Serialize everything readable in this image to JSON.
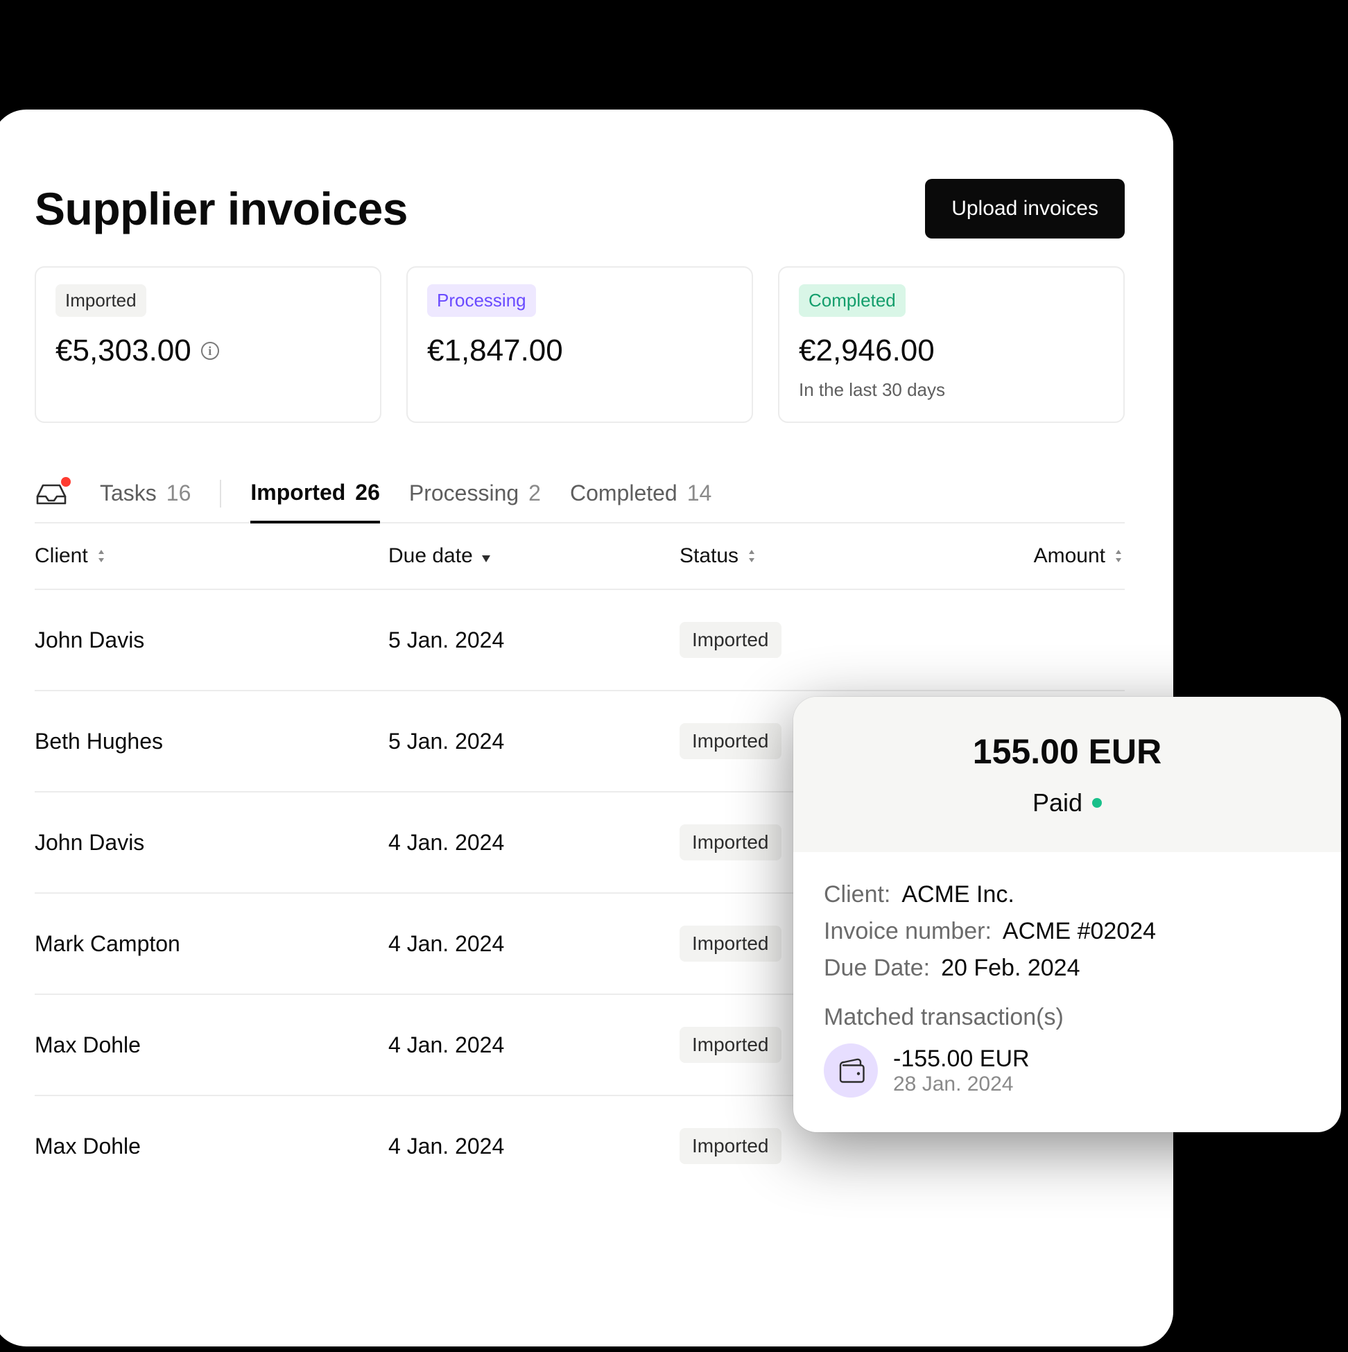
{
  "header": {
    "title": "Supplier invoices",
    "upload_button": "Upload invoices"
  },
  "summary_cards": {
    "imported": {
      "label": "Imported",
      "amount": "€5,303.00"
    },
    "processing": {
      "label": "Processing",
      "amount": "€1,847.00"
    },
    "completed": {
      "label": "Completed",
      "amount": "€2,946.00",
      "sub": "In the last 30 days"
    }
  },
  "tabs": {
    "tasks": {
      "label": "Tasks",
      "count": "16"
    },
    "imported": {
      "label": "Imported",
      "count": "26"
    },
    "processing": {
      "label": "Processing",
      "count": "2"
    },
    "completed": {
      "label": "Completed",
      "count": "14"
    }
  },
  "columns": {
    "client": "Client",
    "due": "Due date",
    "status": "Status",
    "amount": "Amount"
  },
  "rows": [
    {
      "client": "John Davis",
      "due": "5 Jan. 2024",
      "status": "Imported"
    },
    {
      "client": "Beth Hughes",
      "due": "5 Jan. 2024",
      "status": "Imported"
    },
    {
      "client": "John Davis",
      "due": "4 Jan. 2024",
      "status": "Imported"
    },
    {
      "client": "Mark Campton",
      "due": "4 Jan. 2024",
      "status": "Imported"
    },
    {
      "client": "Max Dohle",
      "due": "4 Jan. 2024",
      "status": "Imported"
    },
    {
      "client": "Max Dohle",
      "due": "4 Jan. 2024",
      "status": "Imported"
    }
  ],
  "popover": {
    "amount": "155.00 EUR",
    "status": "Paid",
    "client_label": "Client:",
    "client_value": "ACME Inc.",
    "invoice_label": "Invoice number:",
    "invoice_value": "ACME #02024",
    "due_label": "Due Date:",
    "due_value": "20 Feb. 2024",
    "matched_label": "Matched transaction(s)",
    "tx_amount": "-155.00 EUR",
    "tx_date": "28 Jan. 2024"
  }
}
